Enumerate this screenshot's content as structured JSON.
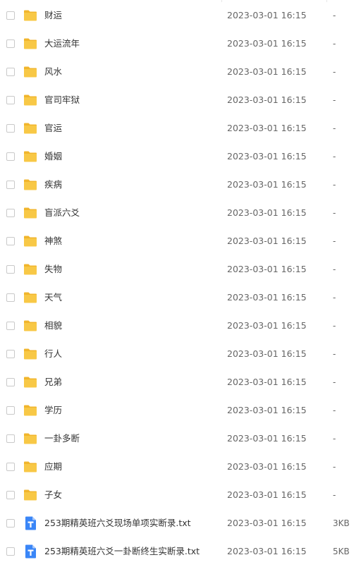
{
  "colors": {
    "folder": "#f8c846",
    "folder_tab": "#f1b52c",
    "text_file": "#3a86f7"
  },
  "files": [
    {
      "type": "folder",
      "icon": "folder-icon",
      "name": "财运",
      "modified": "2023-03-01 16:15",
      "size": "-"
    },
    {
      "type": "folder",
      "icon": "folder-icon",
      "name": "大运流年",
      "modified": "2023-03-01 16:15",
      "size": "-"
    },
    {
      "type": "folder",
      "icon": "folder-icon",
      "name": "风水",
      "modified": "2023-03-01 16:15",
      "size": "-"
    },
    {
      "type": "folder",
      "icon": "folder-icon",
      "name": "官司牢狱",
      "modified": "2023-03-01 16:15",
      "size": "-"
    },
    {
      "type": "folder",
      "icon": "folder-icon",
      "name": "官运",
      "modified": "2023-03-01 16:15",
      "size": "-"
    },
    {
      "type": "folder",
      "icon": "folder-icon",
      "name": "婚姻",
      "modified": "2023-03-01 16:15",
      "size": "-"
    },
    {
      "type": "folder",
      "icon": "folder-icon",
      "name": "疾病",
      "modified": "2023-03-01 16:15",
      "size": "-"
    },
    {
      "type": "folder",
      "icon": "folder-icon",
      "name": "盲派六爻",
      "modified": "2023-03-01 16:15",
      "size": "-"
    },
    {
      "type": "folder",
      "icon": "folder-icon",
      "name": "神煞",
      "modified": "2023-03-01 16:15",
      "size": "-"
    },
    {
      "type": "folder",
      "icon": "folder-icon",
      "name": "失物",
      "modified": "2023-03-01 16:15",
      "size": "-"
    },
    {
      "type": "folder",
      "icon": "folder-icon",
      "name": "天气",
      "modified": "2023-03-01 16:15",
      "size": "-"
    },
    {
      "type": "folder",
      "icon": "folder-icon",
      "name": "相貌",
      "modified": "2023-03-01 16:15",
      "size": "-"
    },
    {
      "type": "folder",
      "icon": "folder-icon",
      "name": "行人",
      "modified": "2023-03-01 16:15",
      "size": "-"
    },
    {
      "type": "folder",
      "icon": "folder-icon",
      "name": "兄弟",
      "modified": "2023-03-01 16:15",
      "size": "-"
    },
    {
      "type": "folder",
      "icon": "folder-icon",
      "name": "学历",
      "modified": "2023-03-01 16:15",
      "size": "-"
    },
    {
      "type": "folder",
      "icon": "folder-icon",
      "name": "一卦多断",
      "modified": "2023-03-01 16:15",
      "size": "-"
    },
    {
      "type": "folder",
      "icon": "folder-icon",
      "name": "应期",
      "modified": "2023-03-01 16:15",
      "size": "-"
    },
    {
      "type": "folder",
      "icon": "folder-icon",
      "name": "子女",
      "modified": "2023-03-01 16:15",
      "size": "-"
    },
    {
      "type": "text",
      "icon": "text-file-icon",
      "name": "253期精英班六爻现场单项实断录.txt",
      "modified": "2023-03-01 16:15",
      "size": "3KB"
    },
    {
      "type": "text",
      "icon": "text-file-icon",
      "name": "253期精英班六爻一卦断终生实断录.txt",
      "modified": "2023-03-01 16:15",
      "size": "5KB"
    }
  ]
}
